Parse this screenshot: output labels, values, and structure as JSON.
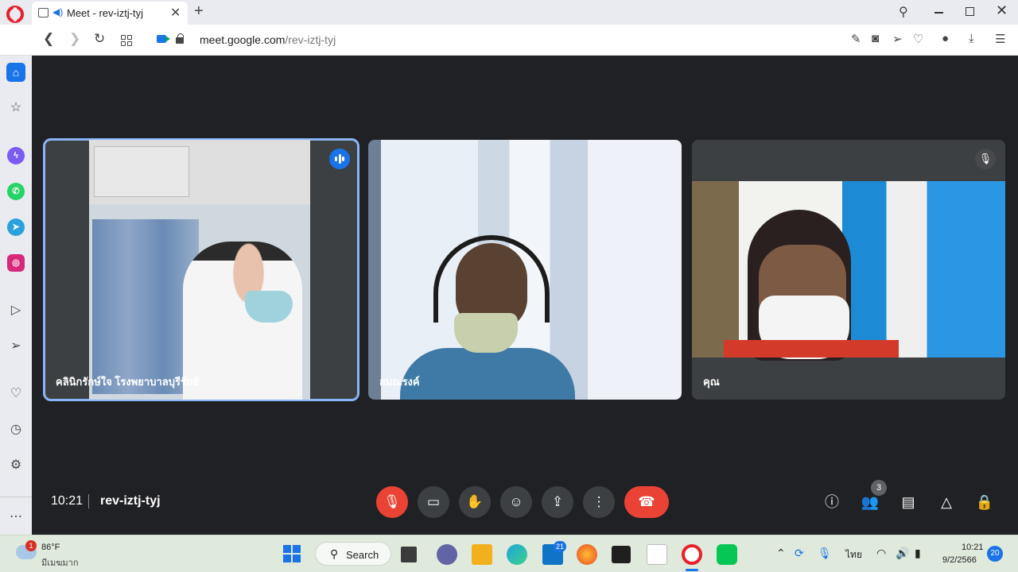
{
  "browser": {
    "tab_title": "Meet - rev-iztj-tyj",
    "new_tab_icon": "+",
    "url_host": "meet.google.com",
    "url_path": "/rev-iztj-tyj"
  },
  "meet": {
    "participants": [
      {
        "name": "คลินิกรักษ์ใจ โรงพยาบาลบุรีรัมย์",
        "state": "speaking"
      },
      {
        "name": "สมณรงค์",
        "state": "normal"
      },
      {
        "name": "คุณ",
        "state": "muted"
      }
    ],
    "time": "10:21",
    "meeting_code": "rev-iztj-tyj",
    "people_count": "3",
    "colors": {
      "accent": "#8ab4f8",
      "hangup": "#ea4335",
      "mic_off": "#ea4335",
      "speaking": "#1a73e8"
    }
  },
  "taskbar": {
    "weather_badge": "1",
    "weather_temp": "86°F",
    "weather_desc": "มีเมฆมาก",
    "search_label": "Search",
    "mail_badge": "21",
    "language": "ไทย",
    "clock_time": "10:21",
    "clock_date": "9/2/2566",
    "notification_count": "20"
  }
}
